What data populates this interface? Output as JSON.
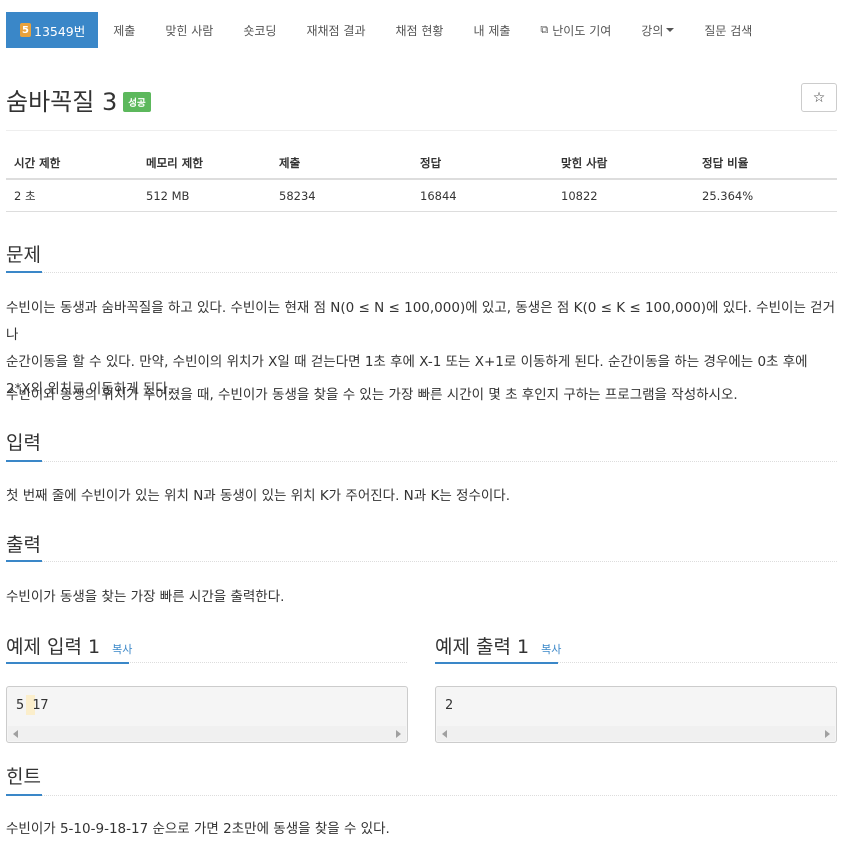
{
  "nav": {
    "problem_number": "13549번",
    "tier_badge": "5",
    "items": [
      "제출",
      "맞힌 사람",
      "숏코딩",
      "재채점 결과",
      "채점 현황",
      "내 제출",
      "난이도 기여",
      "강의",
      "질문 검색"
    ]
  },
  "title": "숨바꼭질 3",
  "status_badge": "성공",
  "star_icon": "☆",
  "stats": {
    "headers": [
      "시간 제한",
      "메모리 제한",
      "제출",
      "정답",
      "맞힌 사람",
      "정답 비율"
    ],
    "values": [
      "2 초",
      "512 MB",
      "58234",
      "16844",
      "10822",
      "25.364%"
    ]
  },
  "sections": {
    "problem": "문제",
    "input": "입력",
    "output": "출력",
    "hint": "힌트"
  },
  "problem_text": {
    "line1": "수빈이는 동생과 숨바꼭질을 하고 있다. 수빈이는 현재 점 N(0 ≤ N ≤ 100,000)에 있고, 동생은 점 K(0 ≤ K ≤ 100,000)에 있다. 수빈이는 걷거나",
    "line2": "순간이동을 할 수 있다. 만약, 수빈이의 위치가 X일 때 걷는다면 1초 후에 X-1 또는 X+1로 이동하게 된다. 순간이동을 하는 경우에는 0초 후에",
    "line3": "2*X의 위치로 이동하게 된다.",
    "line4": "수빈이와 동생의 위치가 주어졌을 때, 수빈이가 동생을 찾을 수 있는 가장 빠른 시간이 몇 초 후인지 구하는 프로그램을 작성하시오."
  },
  "input_text": "첫 번째 줄에 수빈이가 있는 위치 N과 동생이 있는 위치 K가 주어진다. N과 K는 정수이다.",
  "output_text": "수빈이가 동생을 찾는 가장 빠른 시간을 출력한다.",
  "sample_input": {
    "title": "예제 입력 1",
    "copy": "복사",
    "value": "5 17"
  },
  "sample_output": {
    "title": "예제 출력 1",
    "copy": "복사",
    "value": "2"
  },
  "hint_text": "수빈이가 5-10-9-18-17 순으로 가면 2초만에 동생을 찾을 수 있다.",
  "colors": {
    "accent": "#3a87c8",
    "success": "#5cb85c",
    "tier": "#e9a23b"
  }
}
